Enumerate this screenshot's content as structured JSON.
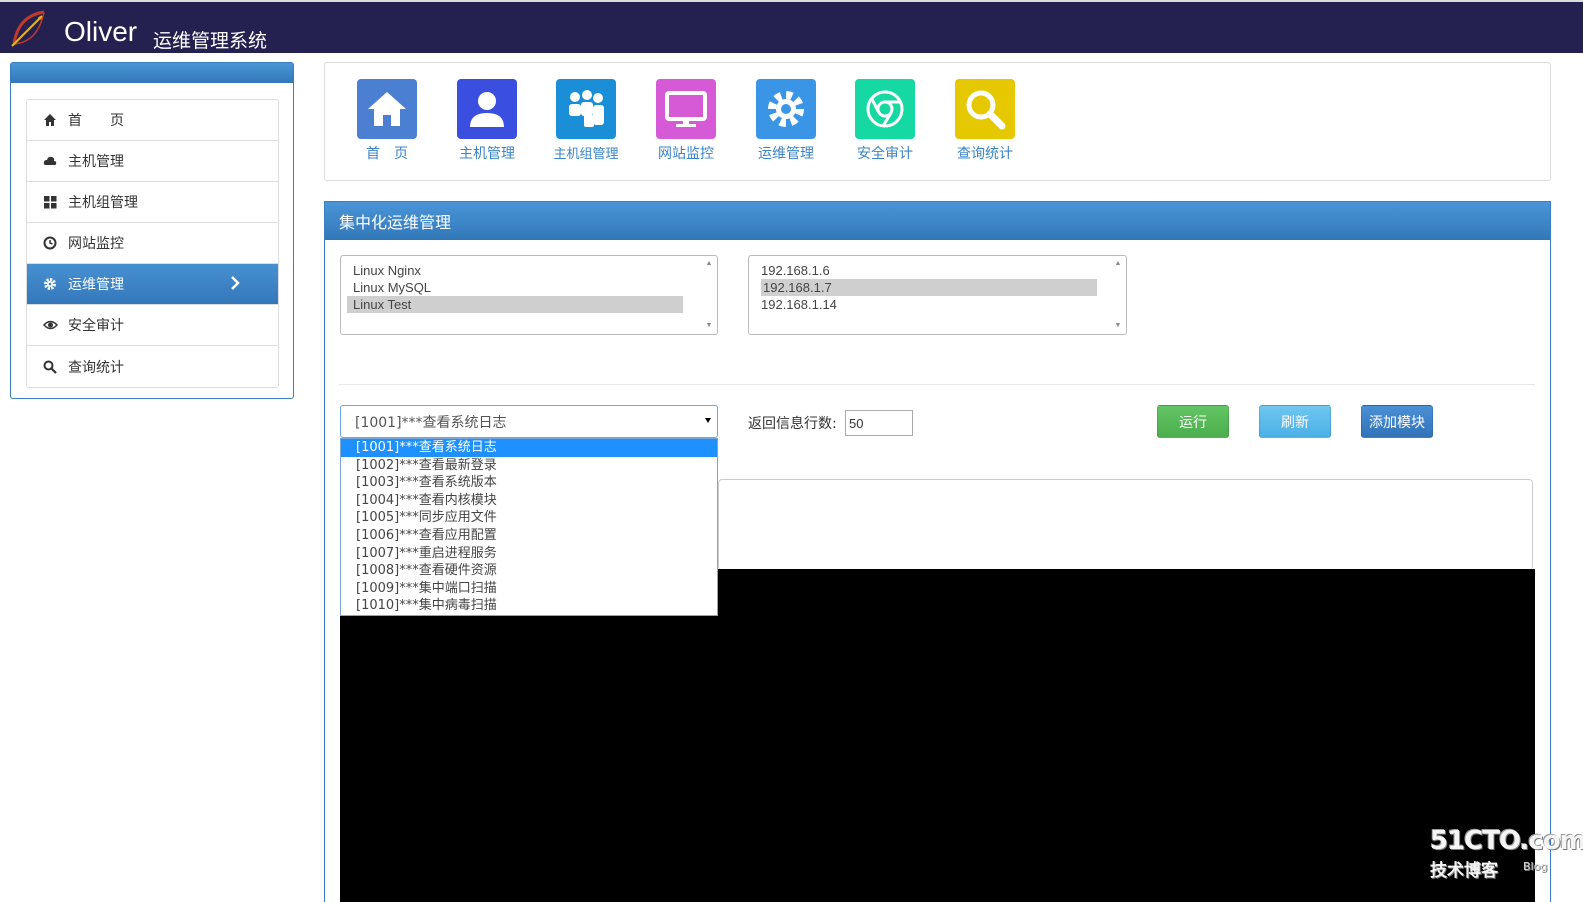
{
  "header": {
    "brand": "Oliver",
    "subtitle": "运维管理系统"
  },
  "sidebar": {
    "items": [
      {
        "label": "首　　页",
        "icon": "home-icon"
      },
      {
        "label": "主机管理",
        "icon": "cloud-icon"
      },
      {
        "label": "主机组管理",
        "icon": "grid-icon"
      },
      {
        "label": "网站监控",
        "icon": "clock-icon"
      },
      {
        "label": "运维管理",
        "icon": "gear-icon",
        "active": true
      },
      {
        "label": "安全审计",
        "icon": "eye-icon"
      },
      {
        "label": "查询统计",
        "icon": "search-icon"
      }
    ]
  },
  "tiles": [
    {
      "label": "首　页",
      "color": "#4a7fd2",
      "icon": "home-icon"
    },
    {
      "label": "主机管理",
      "color": "#3a4fe0",
      "icon": "user-icon"
    },
    {
      "label": "主机组管理",
      "color": "#1a8fd8",
      "icon": "users-icon"
    },
    {
      "label": "网站监控",
      "color": "#d65ad6",
      "icon": "monitor-icon"
    },
    {
      "label": "运维管理",
      "color": "#3b95e6",
      "icon": "gear-icon"
    },
    {
      "label": "安全审计",
      "color": "#15d8a2",
      "icon": "chrome-icon"
    },
    {
      "label": "查询统计",
      "color": "#e6c800",
      "icon": "search-icon"
    }
  ],
  "main": {
    "title": "集中化运维管理",
    "host_groups": [
      "Linux Nginx",
      "Linux MySQL",
      "Linux Test"
    ],
    "hosts": [
      "192.168.1.6",
      "192.168.1.7",
      "192.168.1.14"
    ],
    "module_selected": "[1001]***查看系统日志",
    "module_options": [
      "[1001]***查看系统日志",
      "[1002]***查看最新登录",
      "[1003]***查看系统版本",
      "[1004]***查看内核模块",
      "[1005]***同步应用文件",
      "[1006]***查看应用配置",
      "[1007]***重启进程服务",
      "[1008]***查看硬件资源",
      "[1009]***集中端口扫描",
      "[1010]***集中病毒扫描"
    ],
    "rows_label": "返回信息行数:",
    "rows_value": "50",
    "run_label": "运行",
    "refresh_label": "刷新",
    "add_module_label": "添加模块"
  },
  "watermark": {
    "main": "51CTO.com",
    "sub": "技术博客",
    "blog": "Blog"
  },
  "colors": {
    "topbar": "#24204f",
    "accent": "#3b84c6",
    "run": "#5cb85c",
    "refresh": "#5bc0de",
    "add": "#337ab7"
  }
}
